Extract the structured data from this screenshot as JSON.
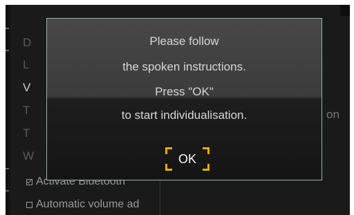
{
  "background_menu": {
    "rows": [
      "D",
      "L",
      "V",
      "T",
      "T",
      "W"
    ],
    "checkbox_items": [
      {
        "label": "Activate Bluetooth",
        "checked": true
      },
      {
        "label": "Automatic volume ad",
        "checked": false
      }
    ],
    "right_fragment": "on"
  },
  "dialog": {
    "lines": [
      "Please follow",
      "the spoken instructions.",
      "Press \"OK\"",
      "to start individualisation."
    ],
    "ok_label": "OK"
  },
  "colors": {
    "dialog_border": "#8fbfb5",
    "focus_bracket": "#f2b100"
  }
}
